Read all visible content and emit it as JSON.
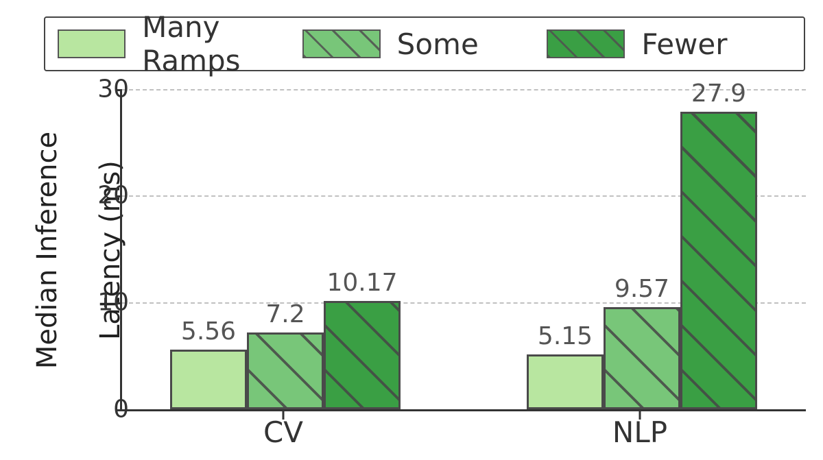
{
  "chart_data": {
    "type": "bar",
    "title": "",
    "xlabel": "",
    "ylabel": "Median Inference Latency (ms)",
    "categories": [
      "CV",
      "NLP"
    ],
    "series": [
      {
        "name": "Many Ramps",
        "values": [
          5.56,
          5.15
        ]
      },
      {
        "name": "Some",
        "values": [
          7.2,
          9.57
        ]
      },
      {
        "name": "Fewer",
        "values": [
          10.17,
          27.9
        ]
      }
    ],
    "ylim": [
      0,
      30
    ],
    "yticks": [
      0,
      10,
      20,
      30
    ],
    "grid": true,
    "legend_position": "top"
  },
  "legend": {
    "items": [
      {
        "label": "Many Ramps"
      },
      {
        "label": "Some"
      },
      {
        "label": "Fewer"
      }
    ]
  },
  "yaxis": {
    "label_line1": "Median Inference",
    "label_line2": "Latency (ms)",
    "ticks": [
      {
        "value": 0,
        "label": "0"
      },
      {
        "value": 10,
        "label": "10"
      },
      {
        "value": 20,
        "label": "20"
      },
      {
        "value": 30,
        "label": "30"
      }
    ]
  },
  "xaxis": {
    "ticks": [
      {
        "label": "CV"
      },
      {
        "label": "NLP"
      }
    ]
  },
  "bars": {
    "cv_many": "5.56",
    "cv_some": "7.2",
    "cv_fewer": "10.17",
    "nlp_many": "5.15",
    "nlp_some": "9.57",
    "nlp_fewer": "27.9"
  }
}
